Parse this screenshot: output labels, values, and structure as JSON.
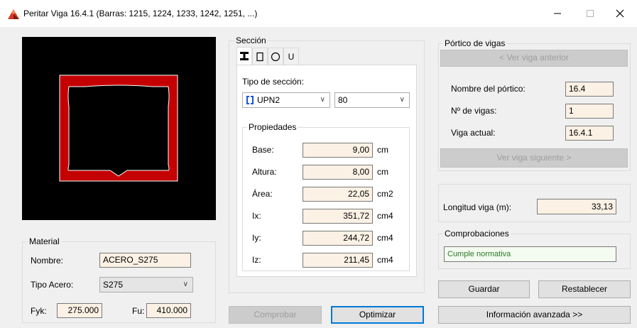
{
  "window": {
    "title": "Peritar Viga 16.4.1 (Barras: 1215, 1224, 1233, 1242, 1251, ...)",
    "icons": {
      "app": "mountain-app-icon",
      "minimize": "minimize-icon",
      "maximize": "maximize-icon",
      "close": "close-icon"
    }
  },
  "material": {
    "legend": "Material",
    "nombre_label": "Nombre:",
    "nombre_value": "ACERO_S275",
    "tipo_acero_label": "Tipo Acero:",
    "tipo_acero_value": "S275",
    "fyk_label": "Fyk:",
    "fyk_value": "275.000",
    "fu_label": "Fu:",
    "fu_value": "410.000"
  },
  "seccion": {
    "legend": "Sección",
    "tabs": [
      {
        "name": "i-beam-icon",
        "active": true
      },
      {
        "name": "rectangle-icon",
        "active": false
      },
      {
        "name": "circle-icon",
        "active": false
      },
      {
        "label": "U",
        "active": false
      }
    ],
    "tipo_label": "Tipo de sección:",
    "tipo_value": "UPN2",
    "size_value": "80",
    "propiedades_legend": "Propiedades",
    "props": [
      {
        "label": "Base:",
        "value": "9,00",
        "unit": "cm"
      },
      {
        "label": "Altura:",
        "value": "8,00",
        "unit": "cm"
      },
      {
        "label": "Área:",
        "value": "22,05",
        "unit": "cm2"
      },
      {
        "label": "Ix:",
        "value": "351,72",
        "unit": "cm4"
      },
      {
        "label": "Iy:",
        "value": "244,72",
        "unit": "cm4"
      },
      {
        "label": "Iz:",
        "value": "211,45",
        "unit": "cm4"
      }
    ]
  },
  "portico": {
    "legend": "Pórtico de vigas",
    "prev_button": "< Ver viga anterior",
    "next_button": "Ver viga siguiente >",
    "nombre_label": "Nombre del pórtico:",
    "nombre_value": "16.4",
    "num_label": "Nº de vigas:",
    "num_value": "1",
    "actual_label": "Viga actual:",
    "actual_value": "16.4.1"
  },
  "longitud": {
    "label": "Longitud viga (m):",
    "value": "33,13"
  },
  "comprobaciones": {
    "legend": "Comprobaciones",
    "status": "Cumple normativa"
  },
  "buttons": {
    "guardar": "Guardar",
    "restablecer": "Restablecer",
    "comprobar": "Comprobar",
    "optimizar": "Optimizar",
    "info": "Información avanzada >>"
  },
  "colors": {
    "section_fill": "#c40000",
    "preview_bg": "#000000",
    "accent": "#0078d7",
    "field_bg": "#fbf1e4"
  }
}
